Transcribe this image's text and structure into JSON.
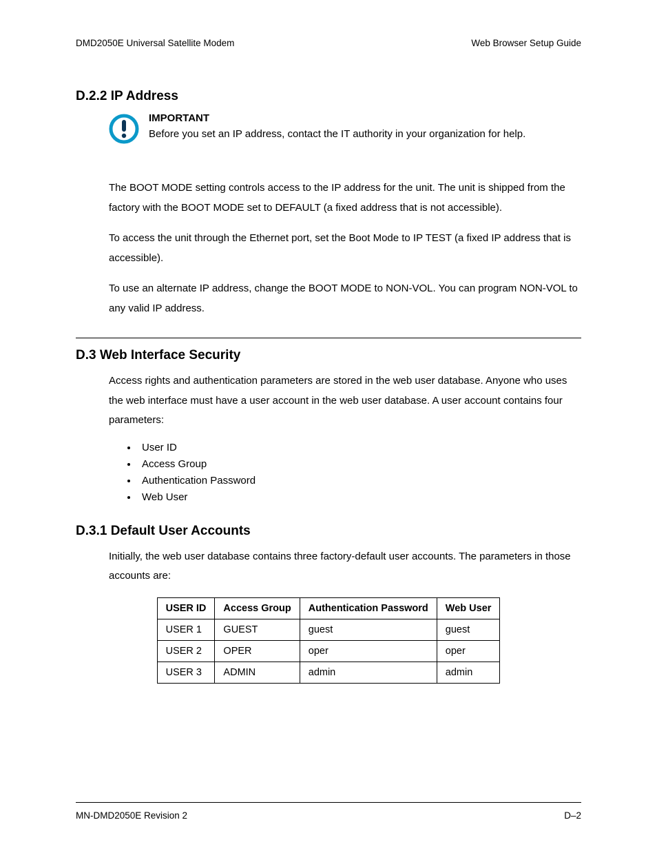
{
  "header": {
    "left": "DMD2050E Universal Satellite Modem",
    "right": "Web Browser Setup Guide"
  },
  "section_d22": {
    "heading": "D.2.2 IP Address",
    "important_label": "IMPORTANT",
    "important_text": "Before you set an IP address, contact the IT authority in your organization for help.",
    "p1": "The BOOT MODE setting controls access to the IP address for the unit. The unit is shipped from the factory with the BOOT MODE set to DEFAULT (a fixed address that is not accessible).",
    "p2": "To access the unit through the Ethernet port, set the Boot Mode to IP TEST (a fixed IP address that is accessible).",
    "p3": "To use an alternate IP address, change the BOOT MODE to NON-VOL. You can program NON-VOL to any valid IP address."
  },
  "section_d3": {
    "heading": "D.3  Web Interface Security",
    "p1": "Access rights and authentication parameters are stored in the web user database. Anyone who uses the web interface must have a user account in the web user database. A user account contains four parameters:",
    "bullets": [
      "User ID",
      "Access Group",
      "Authentication Password",
      "Web User"
    ]
  },
  "section_d31": {
    "heading": "D.3.1 Default User Accounts",
    "p1": "Initially, the web user database contains three factory-default user accounts.  The parameters in those accounts are:",
    "table": {
      "headers": [
        "USER ID",
        "Access Group",
        "Authentication Password",
        "Web User"
      ],
      "rows": [
        [
          "USER 1",
          "GUEST",
          "guest",
          "guest"
        ],
        [
          "USER 2",
          "OPER",
          "oper",
          "oper"
        ],
        [
          "USER 3",
          "ADMIN",
          "admin",
          "admin"
        ]
      ]
    }
  },
  "footer": {
    "left": "MN-DMD2050E   Revision 2",
    "right": "D–2"
  }
}
